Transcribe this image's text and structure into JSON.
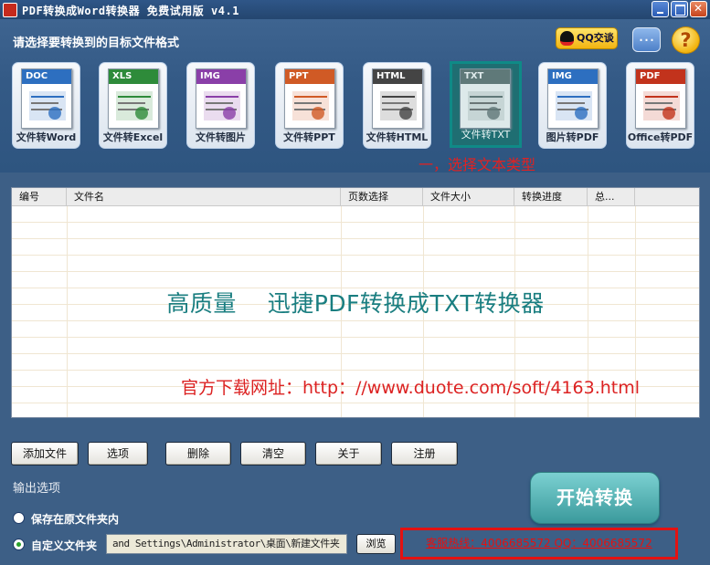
{
  "window": {
    "title": "PDF转换成Word转换器 免费试用版 v4.1"
  },
  "header": {
    "prompt": "请选择要转换到的目标文件格式",
    "qq_label": "QQ交谈",
    "help_glyph": "?"
  },
  "tools": [
    {
      "tag": "DOC",
      "label": "文件转Word",
      "color": "#2d6fc0",
      "icon": "word-doc-icon"
    },
    {
      "tag": "XLS",
      "label": "文件转Excel",
      "color": "#2e8b3a",
      "icon": "excel-chart-icon"
    },
    {
      "tag": "IMG",
      "label": "文件转图片",
      "color": "#8a3fa8",
      "icon": "image-icon"
    },
    {
      "tag": "PPT",
      "label": "文件转PPT",
      "color": "#d05a25",
      "icon": "ppt-icon"
    },
    {
      "tag": "HTML",
      "label": "文件转HTML",
      "color": "#444444",
      "icon": "html-globe-icon"
    },
    {
      "tag": "TXT",
      "label": "文件转TXT",
      "color": "#6b7b7b",
      "icon": "txt-check-icon",
      "selected": true
    },
    {
      "tag": "IMG",
      "label": "图片转PDF",
      "color": "#2d6fc0",
      "icon": "picture-icon"
    },
    {
      "tag": "PDF",
      "label": "Office转PDF",
      "color": "#c2331c",
      "icon": "pdf-acrobat-icon"
    }
  ],
  "annotation": "一，选择文本类型",
  "table": {
    "columns": [
      "编号",
      "文件名",
      "页数选择",
      "文件大小",
      "转换进度",
      "总..."
    ]
  },
  "watermark": {
    "hero_a": "高质量",
    "hero_b": "迅捷PDF转换成TXT转换器",
    "site": "官方下载网址：http：//www.duote.com/soft/4163.html"
  },
  "buttons": {
    "add": "添加文件",
    "options": "选项",
    "delete": "删除",
    "clear": "清空",
    "about": "关于",
    "register": "注册",
    "browse": "浏览",
    "start": "开始转换"
  },
  "output": {
    "label": "输出选项",
    "opt_original": "保存在原文件夹内",
    "opt_custom": "自定义文件夹",
    "path": " and Settings\\Administrator\\桌面\\新建文件夹",
    "hotline": "客服热线：4006685572 QQ：4006685572"
  }
}
